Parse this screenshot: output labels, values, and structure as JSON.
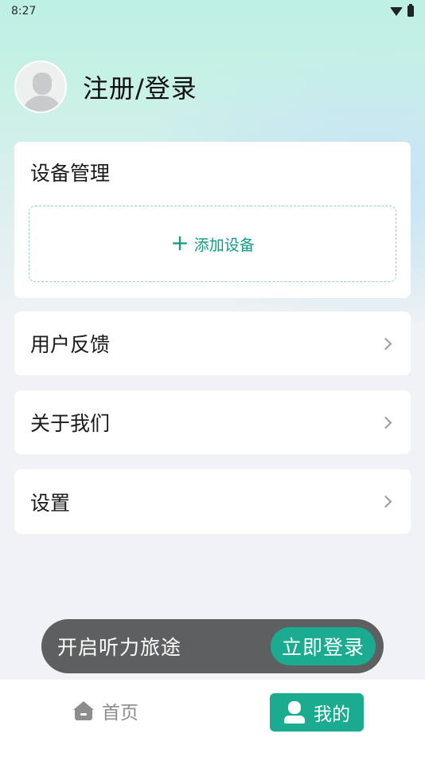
{
  "status_bar": {
    "time": "8:27"
  },
  "profile": {
    "title": "注册/登录"
  },
  "device_card": {
    "title": "设备管理",
    "add_label": "添加设备"
  },
  "menu": {
    "feedback": "用户反馈",
    "about": "关于我们",
    "settings": "设置"
  },
  "login_banner": {
    "text": "开启听力旅途",
    "button": "立即登录"
  },
  "bottom_nav": {
    "home": "首页",
    "mine": "我的"
  },
  "icons": [
    "wifi-icon",
    "battery-icon",
    "avatar-icon",
    "plus-icon",
    "chevron-right-icon",
    "home-icon",
    "user-icon"
  ],
  "colors": {
    "accent": "#1aab90",
    "banner": "#5e5f60"
  }
}
